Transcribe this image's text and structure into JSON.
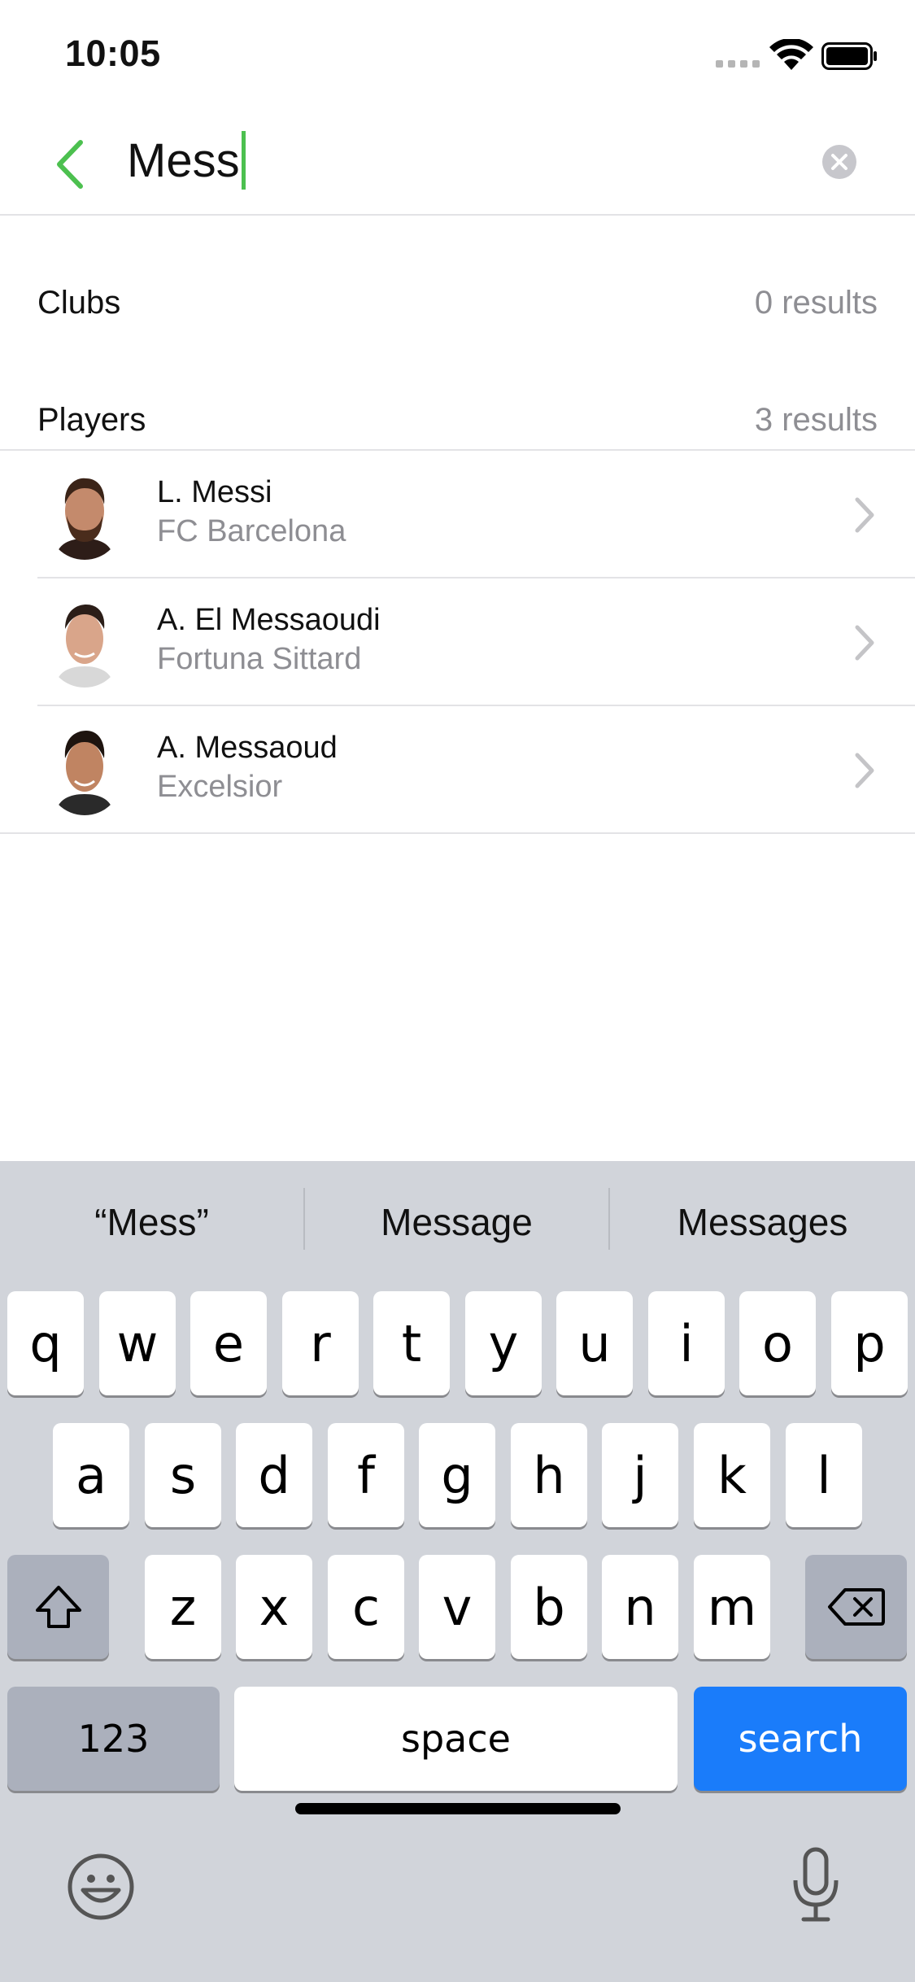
{
  "status_bar": {
    "time": "10:05"
  },
  "search": {
    "query": "Mess"
  },
  "sections": {
    "clubs": {
      "title": "Clubs",
      "count": "0 results"
    },
    "players": {
      "title": "Players",
      "count": "3 results"
    }
  },
  "players": [
    {
      "name": "L. Messi",
      "club": "FC Barcelona"
    },
    {
      "name": "A. El Messaoudi",
      "club": "Fortuna Sittard"
    },
    {
      "name": "A. Messaoud",
      "club": "Excelsior"
    }
  ],
  "keyboard": {
    "suggestions": [
      "“Mess”",
      "Message",
      "Messages"
    ],
    "row1": [
      "q",
      "w",
      "e",
      "r",
      "t",
      "y",
      "u",
      "i",
      "o",
      "p"
    ],
    "row2": [
      "a",
      "s",
      "d",
      "f",
      "g",
      "h",
      "j",
      "k",
      "l"
    ],
    "row3": [
      "z",
      "x",
      "c",
      "v",
      "b",
      "n",
      "m"
    ],
    "numbers_label": "123",
    "space_label": "space",
    "search_label": "search"
  },
  "colors": {
    "accent": "#4cc04f",
    "search_key": "#1a7cfa",
    "keyboard_bg": "#d1d4da"
  }
}
